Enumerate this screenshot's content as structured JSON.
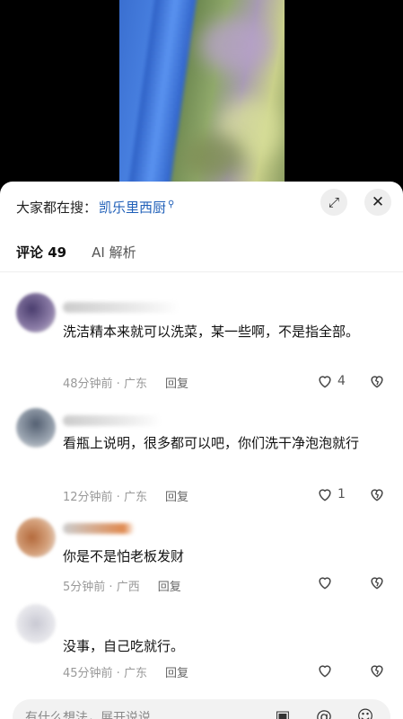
{
  "search": {
    "prefix": "大家都在搜：",
    "term": "凯乐里西厨"
  },
  "tabs": [
    {
      "label": "评论 49"
    },
    {
      "label": "AI 解析"
    }
  ],
  "comments": [
    {
      "text": "洗洁精本来就可以洗菜，某一些啊，不是指全部。",
      "time": "48分钟前",
      "location": "广东",
      "reply": "回复",
      "likes": "4"
    },
    {
      "text": "看瓶上说明，很多都可以吧，你们洗干净泡泡就行",
      "time": "12分钟前",
      "location": "广东",
      "reply": "回复",
      "likes": "1"
    },
    {
      "text": "你是不是怕老板发财",
      "time": "5分钟前",
      "location": "广西",
      "reply": "回复",
      "likes": ""
    },
    {
      "text": "没事，自己吃就行。",
      "time": "45分钟前",
      "location": "广东",
      "reply": "回复",
      "likes": ""
    }
  ],
  "input": {
    "placeholder": "有什么想法，展开说说"
  },
  "icons": [
    "expand-icon",
    "close-icon",
    "search-icon",
    "heart-icon",
    "dislike-heart-icon",
    "image-icon",
    "at-icon",
    "emoji-icon"
  ],
  "colors": {
    "link": "#1f5fb8",
    "text": "#111111",
    "meta": "#999999"
  }
}
